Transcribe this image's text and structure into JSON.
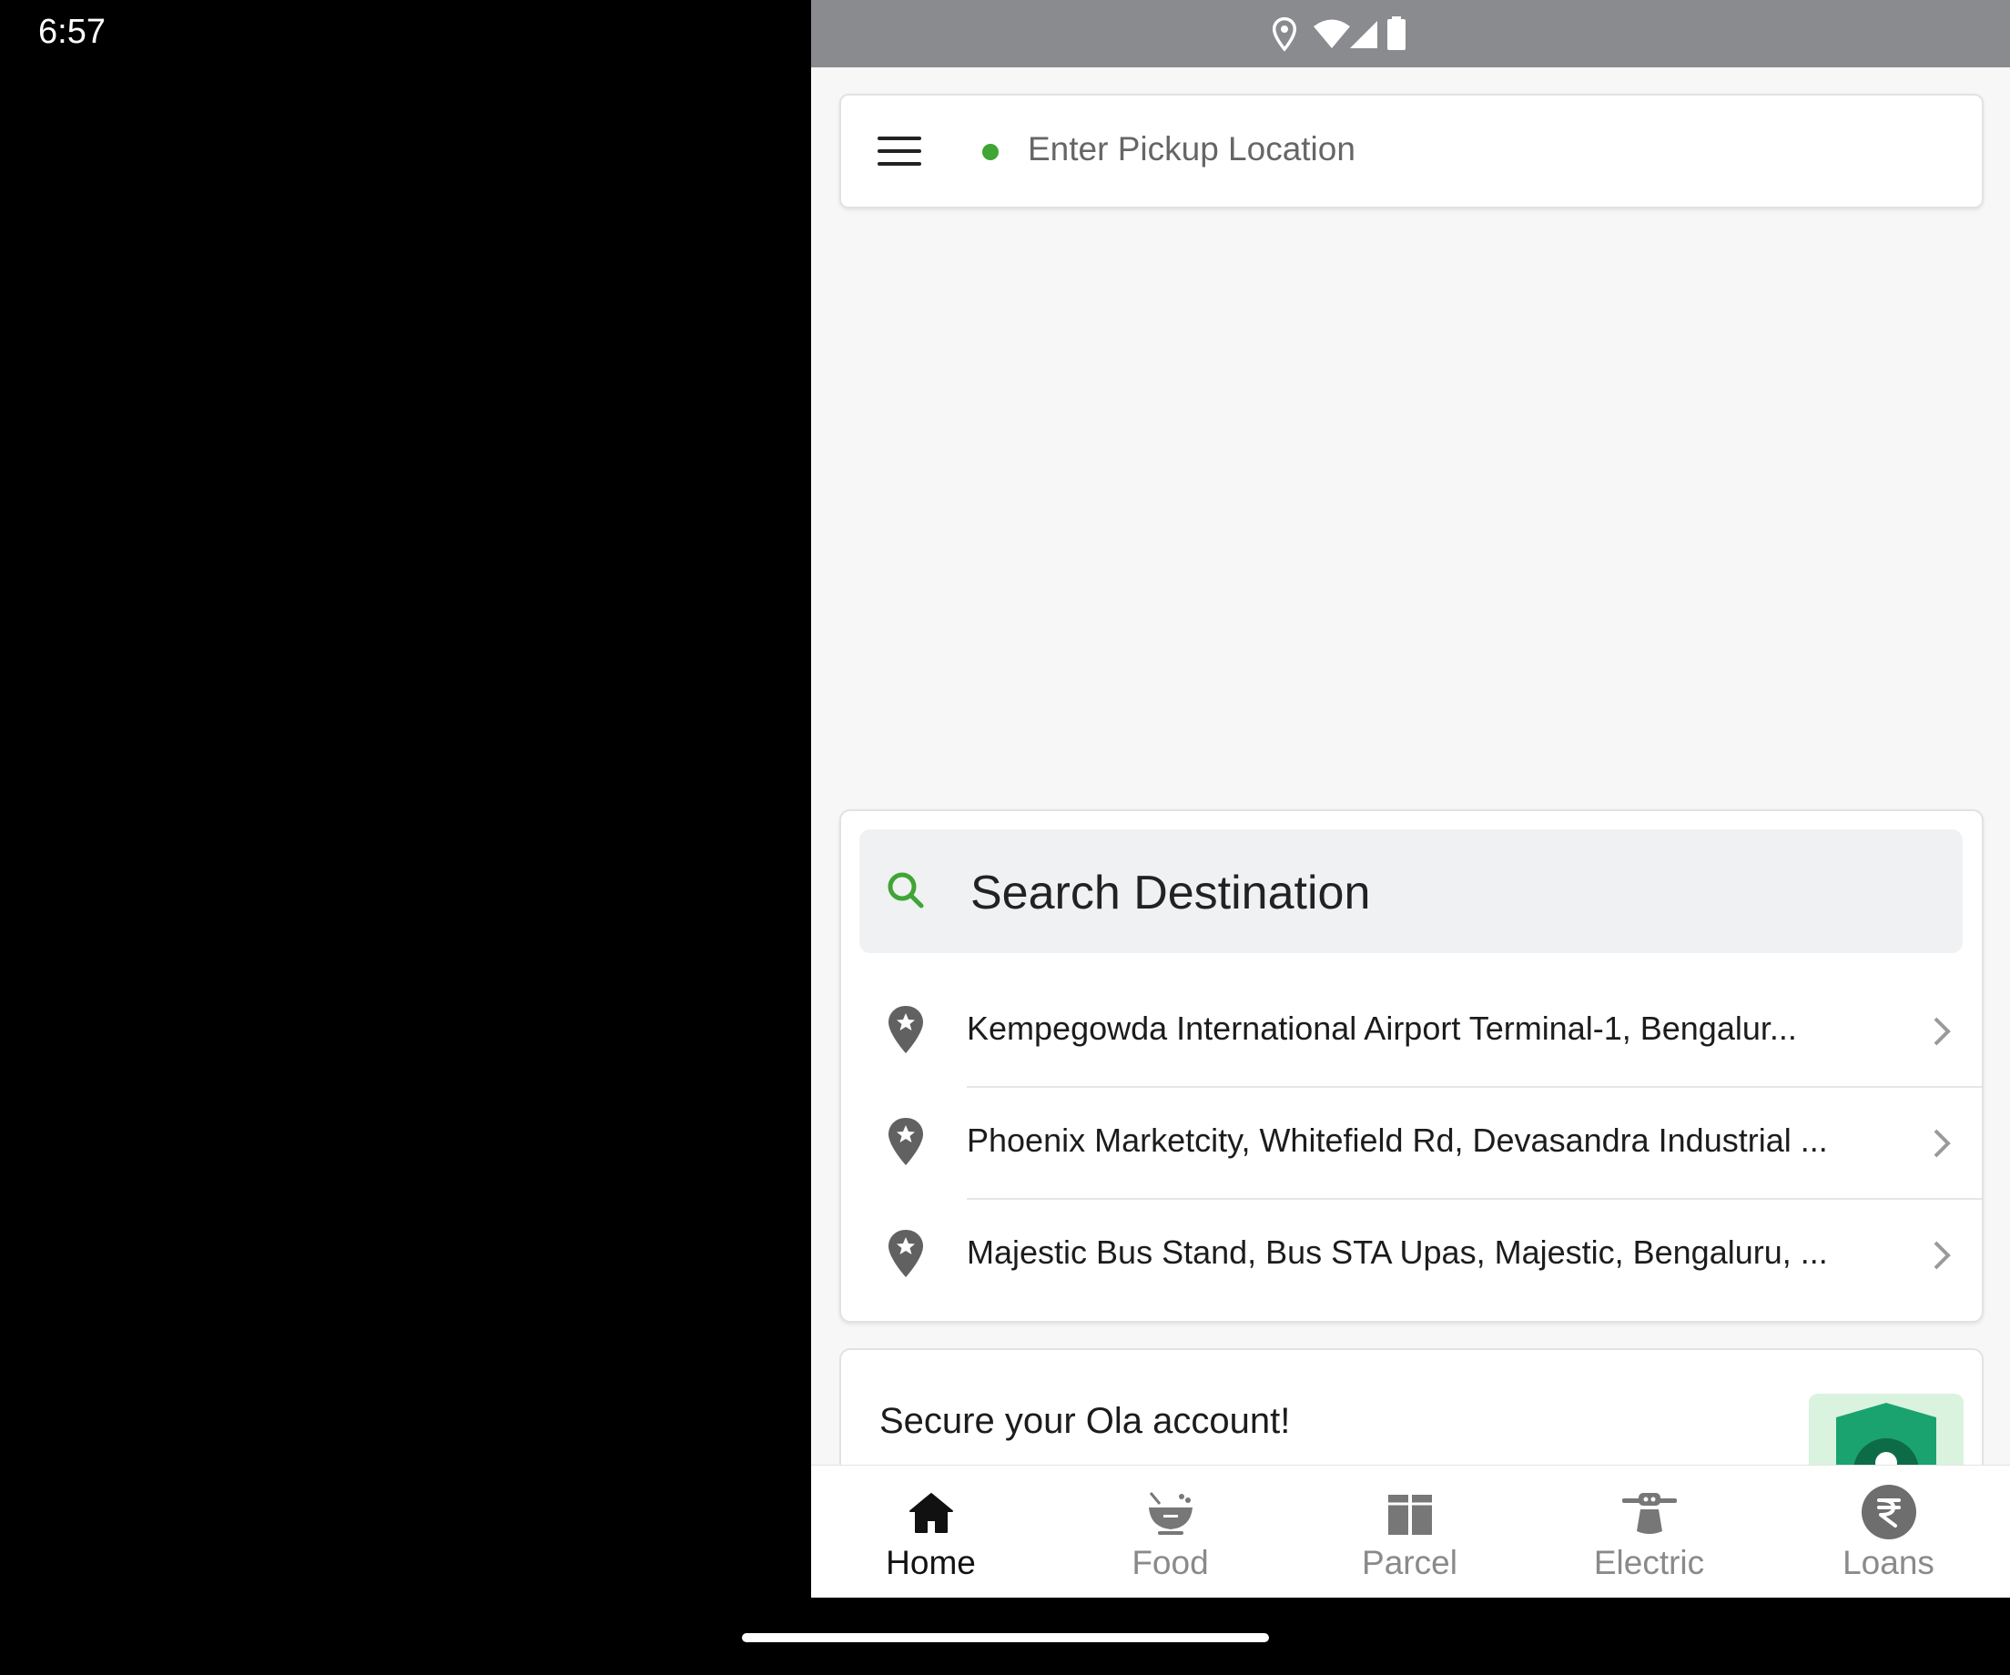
{
  "status_bar": {
    "time": "6:57",
    "icons": [
      "location-icon",
      "wifi-icon",
      "signal-icon",
      "battery-icon"
    ]
  },
  "pickup": {
    "placeholder": "Enter Pickup Location",
    "dot_color": "#3fa535"
  },
  "destination": {
    "search_label": "Search Destination",
    "recent": [
      {
        "label": "Kempegowda International Airport Terminal-1, Bengalur..."
      },
      {
        "label": "Phoenix Marketcity, Whitefield Rd, Devasandra Industrial ..."
      },
      {
        "label": "Majestic Bus Stand, Bus STA Upas, Majestic, Bengaluru, ..."
      }
    ]
  },
  "promo": {
    "title": "Secure your Ola account!"
  },
  "bottom_nav": {
    "items": [
      {
        "label": "Home",
        "icon": "home-icon",
        "active": true
      },
      {
        "label": "Food",
        "icon": "food-bowl-icon",
        "active": false
      },
      {
        "label": "Parcel",
        "icon": "parcel-box-icon",
        "active": false
      },
      {
        "label": "Electric",
        "icon": "electric-scooter-icon",
        "active": false
      },
      {
        "label": "Loans",
        "icon": "rupee-icon",
        "active": false
      }
    ]
  },
  "colors": {
    "accent_green": "#3fa535",
    "status_bar": "#8a8b8e",
    "shield_green": "#1aa36f"
  }
}
